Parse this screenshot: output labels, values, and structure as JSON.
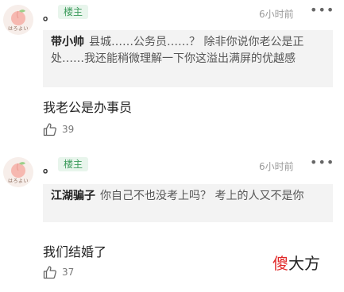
{
  "comments": [
    {
      "username": "。",
      "badge": "楼主",
      "avatar_text": "はろよい",
      "time": "6小时前",
      "more": "•••",
      "quote_author": "带小帅",
      "quote_text": "县城……公务员……？ 除非你说你老公是正处……我还能稍微理解一下你这溢出满屏的优越感",
      "body": "我老公是办事员",
      "likes": "39"
    },
    {
      "username": "。",
      "badge": "楼主",
      "avatar_text": "はろよい",
      "time": "6小时前",
      "more": "•••",
      "quote_author": "江湖骗子",
      "quote_text": "你自己不也没考上吗？ 考上的人又不是你",
      "body": "我们结婚了",
      "likes": "37"
    }
  ],
  "watermark": {
    "red": "傻",
    "black": "大方"
  },
  "colors": {
    "badge_bg": "#e8f5ec",
    "badge_text": "#3a9a5a",
    "quote_bg": "#f3f3f3",
    "watermark_red": "#e02a2a"
  }
}
